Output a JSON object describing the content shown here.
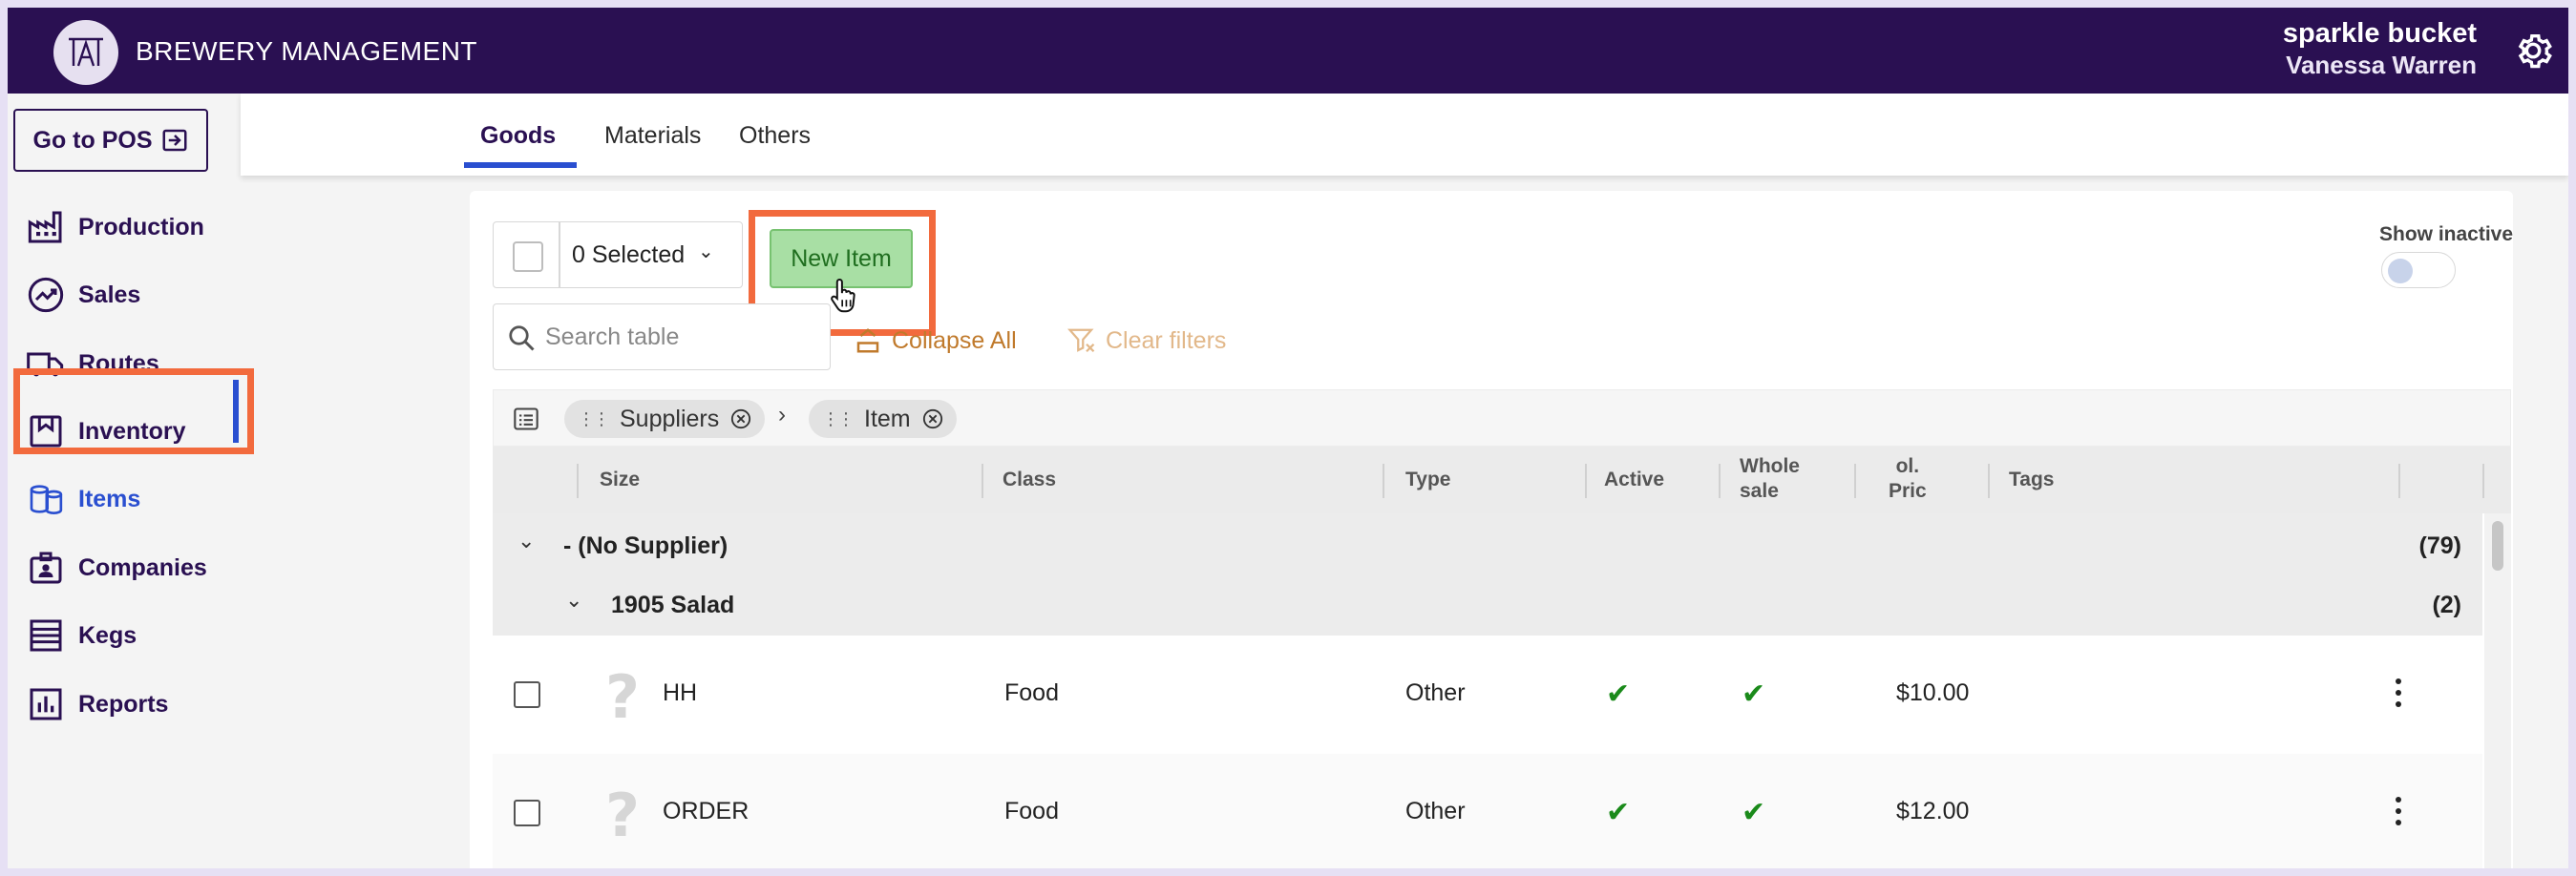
{
  "header": {
    "app_title": "BREWERY MANAGEMENT",
    "company": "sparkle bucket",
    "user": "Vanessa Warren"
  },
  "sidebar": {
    "pos_button": "Go to POS",
    "items": [
      {
        "label": "Production",
        "icon": "factory-icon"
      },
      {
        "label": "Sales",
        "icon": "trending-up-icon"
      },
      {
        "label": "Routes",
        "icon": "truck-icon"
      },
      {
        "label": "Inventory",
        "icon": "bookmark-box-icon"
      },
      {
        "label": "Items",
        "icon": "cylinders-icon",
        "active": true
      },
      {
        "label": "Companies",
        "icon": "id-badge-icon"
      },
      {
        "label": "Kegs",
        "icon": "keg-icon"
      },
      {
        "label": "Reports",
        "icon": "bar-chart-icon"
      }
    ]
  },
  "tabs": [
    {
      "label": "Goods",
      "active": true
    },
    {
      "label": "Materials"
    },
    {
      "label": "Others"
    }
  ],
  "toolbar": {
    "selected_label": "0 Selected",
    "new_item_label": "New Item",
    "search_placeholder": "Search table",
    "collapse_all_label": "Collapse All",
    "clear_filters_label": "Clear filters",
    "show_inactive_label": "Show inactive"
  },
  "grouping": {
    "chips": [
      "Suppliers",
      "Item"
    ]
  },
  "table": {
    "headers": {
      "size": "Size",
      "class": "Class",
      "type": "Type",
      "active": "Active",
      "wholesale_1": "Whole",
      "wholesale_2": "sale",
      "price_1": "ol.",
      "price_2": "Pric",
      "tags": "Tags"
    },
    "groups": [
      {
        "label": "- (No Supplier)",
        "count": "(79)"
      },
      {
        "label": "1905 Salad",
        "count": "(2)"
      }
    ],
    "rows": [
      {
        "name": "HH",
        "class": "Food",
        "type": "Other",
        "active": true,
        "wholesale": true,
        "price": "$10.00"
      },
      {
        "name": "ORDER",
        "class": "Food",
        "type": "Other",
        "active": true,
        "wholesale": true,
        "price": "$12.00"
      }
    ]
  },
  "colors": {
    "header_bg": "#2a1052",
    "accent_blue": "#2a4fd0",
    "highlight": "#f26a3d",
    "new_button_bg": "#a8dfa4",
    "check_green": "#1a8a1a"
  }
}
